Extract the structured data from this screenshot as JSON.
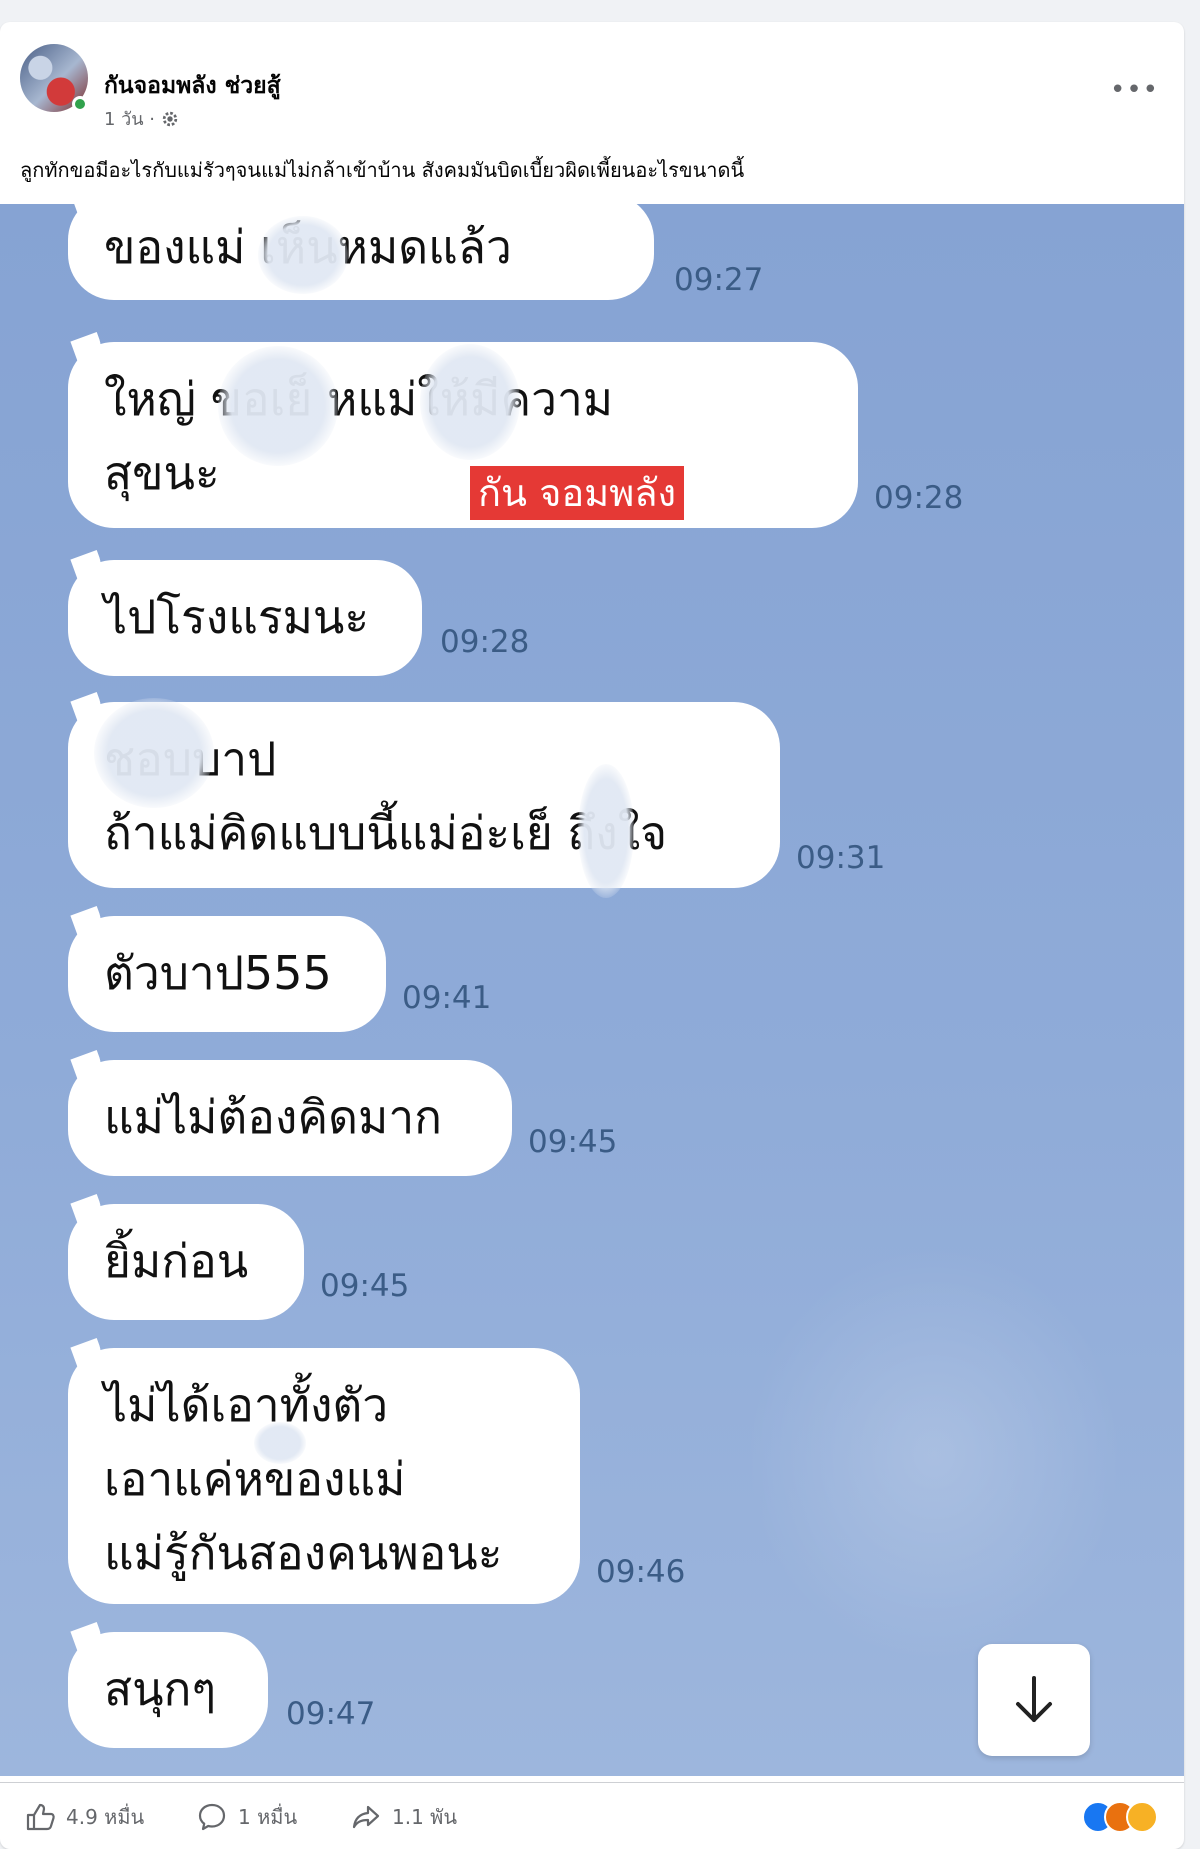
{
  "post": {
    "author": "กันจอมพลัง ช่วยสู้",
    "time": "1 วัน ·",
    "caption": "ลูกทักขอมีอะไรกับแม่รัวๆจนแม่ไม่กล้าเข้าบ้าน สังคมมันบิดเบี้ยวผิดเพี้ยนอะไรขนาดนี้",
    "more": "•••"
  },
  "chat": {
    "watermark": "กัน จอมพลัง",
    "messages": [
      {
        "lines": [
          "ของแม่          เห็นหมดแล้ว"
        ],
        "time": "09:27"
      },
      {
        "lines": [
          "ใหญ่           ขอเย็  หแม่ให้มีความ",
          "สุขนะ"
        ],
        "time": "09:28"
      },
      {
        "lines": [
          "ไปโรงแรมนะ"
        ],
        "time": "09:28"
      },
      {
        "lines": [
          "       ชอบบาป",
          "ถ้าแม่คิดแบบนี้แม่อ่ะเย็   ถึงใจ"
        ],
        "time": "09:31"
      },
      {
        "lines": [
          "ตัวบาป555"
        ],
        "time": "09:41"
      },
      {
        "lines": [
          "แม่ไม่ต้องคิดมาก"
        ],
        "time": "09:45"
      },
      {
        "lines": [
          "ยิ้มก่อน"
        ],
        "time": "09:45"
      },
      {
        "lines": [
          "ไม่ได้เอาทั้งตัว",
          "เอาแค่หของแม่",
          "แม่รู้กันสองคนพอนะ"
        ],
        "time": "09:46"
      },
      {
        "lines": [
          "สนุกๆ"
        ],
        "time": "09:47"
      }
    ]
  },
  "footer": {
    "likes": "4.9 หมื่น",
    "comments": "1 หมื่น",
    "shares": "1.1 พัน"
  },
  "colors": {
    "chat_bg": "#8eaad6",
    "bubble": "#ffffff",
    "time": "#3b5c86",
    "watermark_bg": "#e53935"
  }
}
